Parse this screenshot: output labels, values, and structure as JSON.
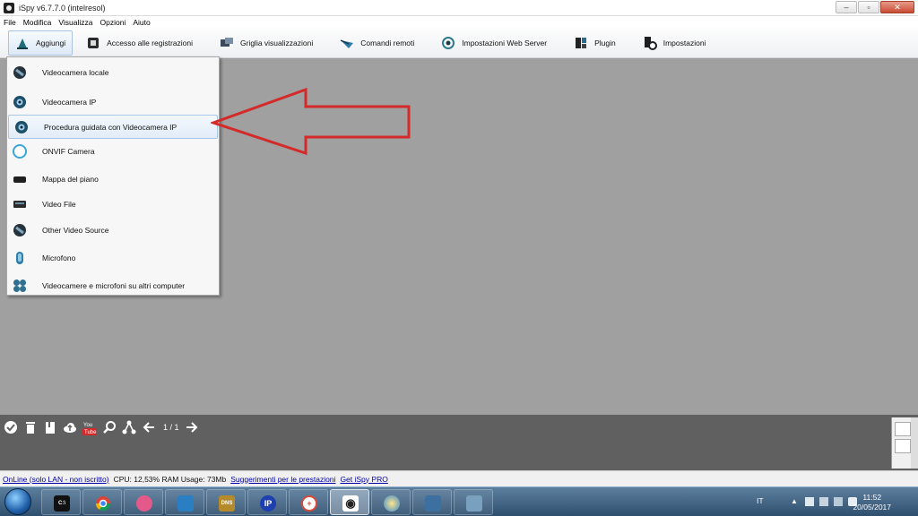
{
  "window": {
    "title": "iSpy v6.7.7.0 (intelresol)",
    "buttons": [
      "–",
      "▫",
      "✕"
    ]
  },
  "menubar": [
    "File",
    "Modifica",
    "Visualizza",
    "Opzioni",
    "Aiuto"
  ],
  "toolbar": [
    {
      "label": "Aggiungi",
      "icon": "add-camera-icon",
      "active": true
    },
    {
      "label": "Accesso alle registrazioni",
      "icon": "recordings-icon"
    },
    {
      "label": "Griglia visualizzazioni",
      "icon": "grid-view-icon"
    },
    {
      "label": "Comandi remoti",
      "icon": "remote-command-icon"
    },
    {
      "label": "Impostazioni Web Server",
      "icon": "web-server-icon"
    },
    {
      "label": "Plugin",
      "icon": "plugin-icon"
    },
    {
      "label": "Impostazioni",
      "icon": "settings-icon"
    }
  ],
  "dropdown": [
    {
      "label": "Videocamera locale",
      "icon": "local-camera-icon"
    },
    {
      "label": "Videocamera IP",
      "icon": "ip-camera-icon"
    },
    {
      "label": "Procedura guidata con Videocamera IP",
      "icon": "ip-camera-wizard-icon",
      "highlighted": true
    },
    {
      "label": "ONVIF Camera",
      "icon": "onvif-camera-icon"
    },
    {
      "label": "Mappa del piano",
      "icon": "floor-plan-icon"
    },
    {
      "label": "Video File",
      "icon": "video-file-icon"
    },
    {
      "label": "Other Video Source",
      "icon": "other-video-source-icon"
    },
    {
      "label": "Microfono",
      "icon": "microphone-icon"
    },
    {
      "label": "Videocamere e microfoni su altri computer",
      "icon": "remote-devices-icon"
    }
  ],
  "bottombar": {
    "icons": [
      "check-icon",
      "trash-icon",
      "book-icon",
      "cloud-upload-icon",
      "youtube-icon",
      "search-icon",
      "share-icon",
      "arrow-left-icon"
    ],
    "page": "1 / 1",
    "next_icon": "arrow-right-icon"
  },
  "statusbar": {
    "online_link": "OnLine (solo LAN - non iscritto)",
    "stats": "CPU: 12,53% RAM Usage: 73Mb",
    "perf_link": "Suggerimenti per le prestazioni",
    "pro_link": "Get iSpy PRO"
  },
  "taskbar": {
    "apps": [
      {
        "name": "cmd-icon",
        "glyph": "C:\\",
        "color": "#111111"
      },
      {
        "name": "chrome-icon",
        "glyph": "",
        "color": "#e0a020"
      },
      {
        "name": "paint-icon",
        "glyph": "",
        "color": "#e35a8a"
      },
      {
        "name": "remote-desktop-icon",
        "glyph": "",
        "color": "#2a7fc2"
      },
      {
        "name": "dns-icon",
        "glyph": "DNS",
        "color": "#b58a2a"
      },
      {
        "name": "ip-icon",
        "glyph": "IP",
        "color": "#1d3fb0"
      },
      {
        "name": "network-icon",
        "glyph": "+",
        "color": "#d84a3a"
      },
      {
        "name": "ispy-eye-icon",
        "glyph": "◉",
        "color": "#222222"
      },
      {
        "name": "globe-icon",
        "glyph": "",
        "color": "#3a8ad0"
      },
      {
        "name": "touch-app-icon",
        "glyph": "",
        "color": "#3d6fa0"
      },
      {
        "name": "paint-brush-icon",
        "glyph": "",
        "color": "#7aa0c0"
      }
    ],
    "language": "IT",
    "time": "11:52",
    "date": "20/05/2017"
  }
}
